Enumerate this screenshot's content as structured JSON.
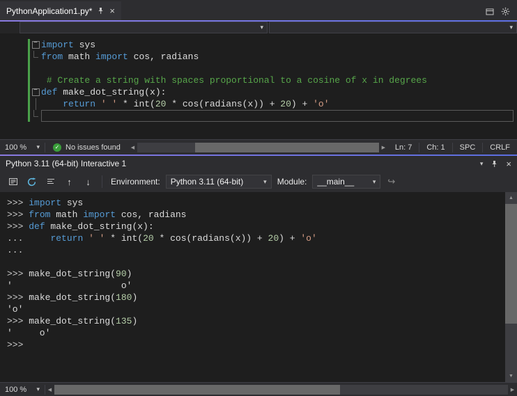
{
  "colors": {
    "accent": "#6f74e0",
    "chrome_background": "#2d2d30",
    "editor_background": "#1e1e1e",
    "keyword": "#569cd6",
    "comment": "#57a64a",
    "string": "#d69d85",
    "number": "#b5cea8",
    "change_bar_green": "#4aa14a",
    "issues_ok_green": "#3a9e3a"
  },
  "icons": {
    "close": "×",
    "caret_down": "▾",
    "check": "✓",
    "up_arrow": "↑",
    "down_arrow": "↓",
    "redo": "↪",
    "scroll_left": "◀",
    "scroll_right": "▶",
    "scroll_up": "▲",
    "scroll_down": "▼"
  },
  "doc_tab": {
    "title": "PythonApplication1.py*"
  },
  "editor": {
    "lines": [
      {
        "fold": "box",
        "changed": true,
        "segs": [
          {
            "c": "kw",
            "t": "import"
          },
          {
            "c": "pl",
            "t": " sys"
          }
        ]
      },
      {
        "fold": "end",
        "changed": true,
        "segs": [
          {
            "c": "kw",
            "t": "from"
          },
          {
            "c": "pl",
            "t": " math "
          },
          {
            "c": "kw",
            "t": "import"
          },
          {
            "c": "pl",
            "t": " cos, radians"
          }
        ]
      },
      {
        "fold": "none",
        "changed": true,
        "segs": []
      },
      {
        "fold": "none",
        "changed": true,
        "segs": [
          {
            "c": "pl",
            "t": " "
          },
          {
            "c": "cm",
            "t": "# Create a string with spaces proportional to a cosine of x in degrees"
          }
        ]
      },
      {
        "fold": "box",
        "changed": true,
        "segs": [
          {
            "c": "kw",
            "t": "def"
          },
          {
            "c": "pl",
            "t": " make_dot_string(x):"
          }
        ]
      },
      {
        "fold": "line",
        "changed": true,
        "segs": [
          {
            "c": "pl",
            "t": "    "
          },
          {
            "c": "kw",
            "t": "return"
          },
          {
            "c": "pl",
            "t": " "
          },
          {
            "c": "st",
            "t": "' '"
          },
          {
            "c": "pl",
            "t": " * int("
          },
          {
            "c": "nu",
            "t": "20"
          },
          {
            "c": "pl",
            "t": " * cos(radians(x)) + "
          },
          {
            "c": "nu",
            "t": "20"
          },
          {
            "c": "pl",
            "t": ") + "
          },
          {
            "c": "st",
            "t": "'o'"
          }
        ]
      },
      {
        "fold": "end",
        "changed": true,
        "cur": true,
        "segs": []
      }
    ]
  },
  "editor_status": {
    "zoom": "100 %",
    "message": "No issues found",
    "line": "Ln: 7",
    "column": "Ch: 1",
    "spaces": "SPC",
    "line_ending": "CRLF"
  },
  "interactive": {
    "title": "Python 3.11 (64-bit) Interactive 1",
    "toolbar": {
      "environment_label": "Environment:",
      "environment_value": "Python 3.11 (64-bit)",
      "module_label": "Module:",
      "module_value": "__main__"
    },
    "lines": [
      {
        "segs": [
          {
            "c": "pr",
            "t": ">>> "
          },
          {
            "c": "kw",
            "t": "import"
          },
          {
            "c": "pl",
            "t": " sys"
          }
        ]
      },
      {
        "segs": [
          {
            "c": "pr",
            "t": ">>> "
          },
          {
            "c": "kw",
            "t": "from"
          },
          {
            "c": "pl",
            "t": " math "
          },
          {
            "c": "kw",
            "t": "import"
          },
          {
            "c": "pl",
            "t": " cos, radians"
          }
        ]
      },
      {
        "segs": [
          {
            "c": "pr",
            "t": ">>> "
          },
          {
            "c": "kw",
            "t": "def"
          },
          {
            "c": "pl",
            "t": " make_dot_string(x):"
          }
        ]
      },
      {
        "segs": [
          {
            "c": "pr",
            "t": "... "
          },
          {
            "c": "pl",
            "t": "    "
          },
          {
            "c": "kw",
            "t": "return"
          },
          {
            "c": "pl",
            "t": " "
          },
          {
            "c": "st",
            "t": "' '"
          },
          {
            "c": "pl",
            "t": " * int("
          },
          {
            "c": "nu",
            "t": "20"
          },
          {
            "c": "pl",
            "t": " * cos(radians(x)) + "
          },
          {
            "c": "nu",
            "t": "20"
          },
          {
            "c": "pl",
            "t": ") + "
          },
          {
            "c": "st",
            "t": "'o'"
          }
        ]
      },
      {
        "segs": [
          {
            "c": "pr",
            "t": "..."
          }
        ]
      },
      {
        "segs": []
      },
      {
        "segs": [
          {
            "c": "pr",
            "t": ">>> "
          },
          {
            "c": "pl",
            "t": "make_dot_string("
          },
          {
            "c": "nu",
            "t": "90"
          },
          {
            "c": "pl",
            "t": ")"
          }
        ]
      },
      {
        "segs": [
          {
            "c": "pl",
            "t": "'                    o'"
          }
        ]
      },
      {
        "segs": [
          {
            "c": "pr",
            "t": ">>> "
          },
          {
            "c": "pl",
            "t": "make_dot_string("
          },
          {
            "c": "nu",
            "t": "180"
          },
          {
            "c": "pl",
            "t": ")"
          }
        ]
      },
      {
        "segs": [
          {
            "c": "pl",
            "t": "'o'"
          }
        ]
      },
      {
        "segs": [
          {
            "c": "pr",
            "t": ">>> "
          },
          {
            "c": "pl",
            "t": "make_dot_string("
          },
          {
            "c": "nu",
            "t": "135"
          },
          {
            "c": "pl",
            "t": ")"
          }
        ]
      },
      {
        "segs": [
          {
            "c": "pl",
            "t": "'     o'"
          }
        ]
      },
      {
        "segs": [
          {
            "c": "pr",
            "t": ">>>"
          }
        ]
      }
    ],
    "status_zoom": "100 %"
  }
}
